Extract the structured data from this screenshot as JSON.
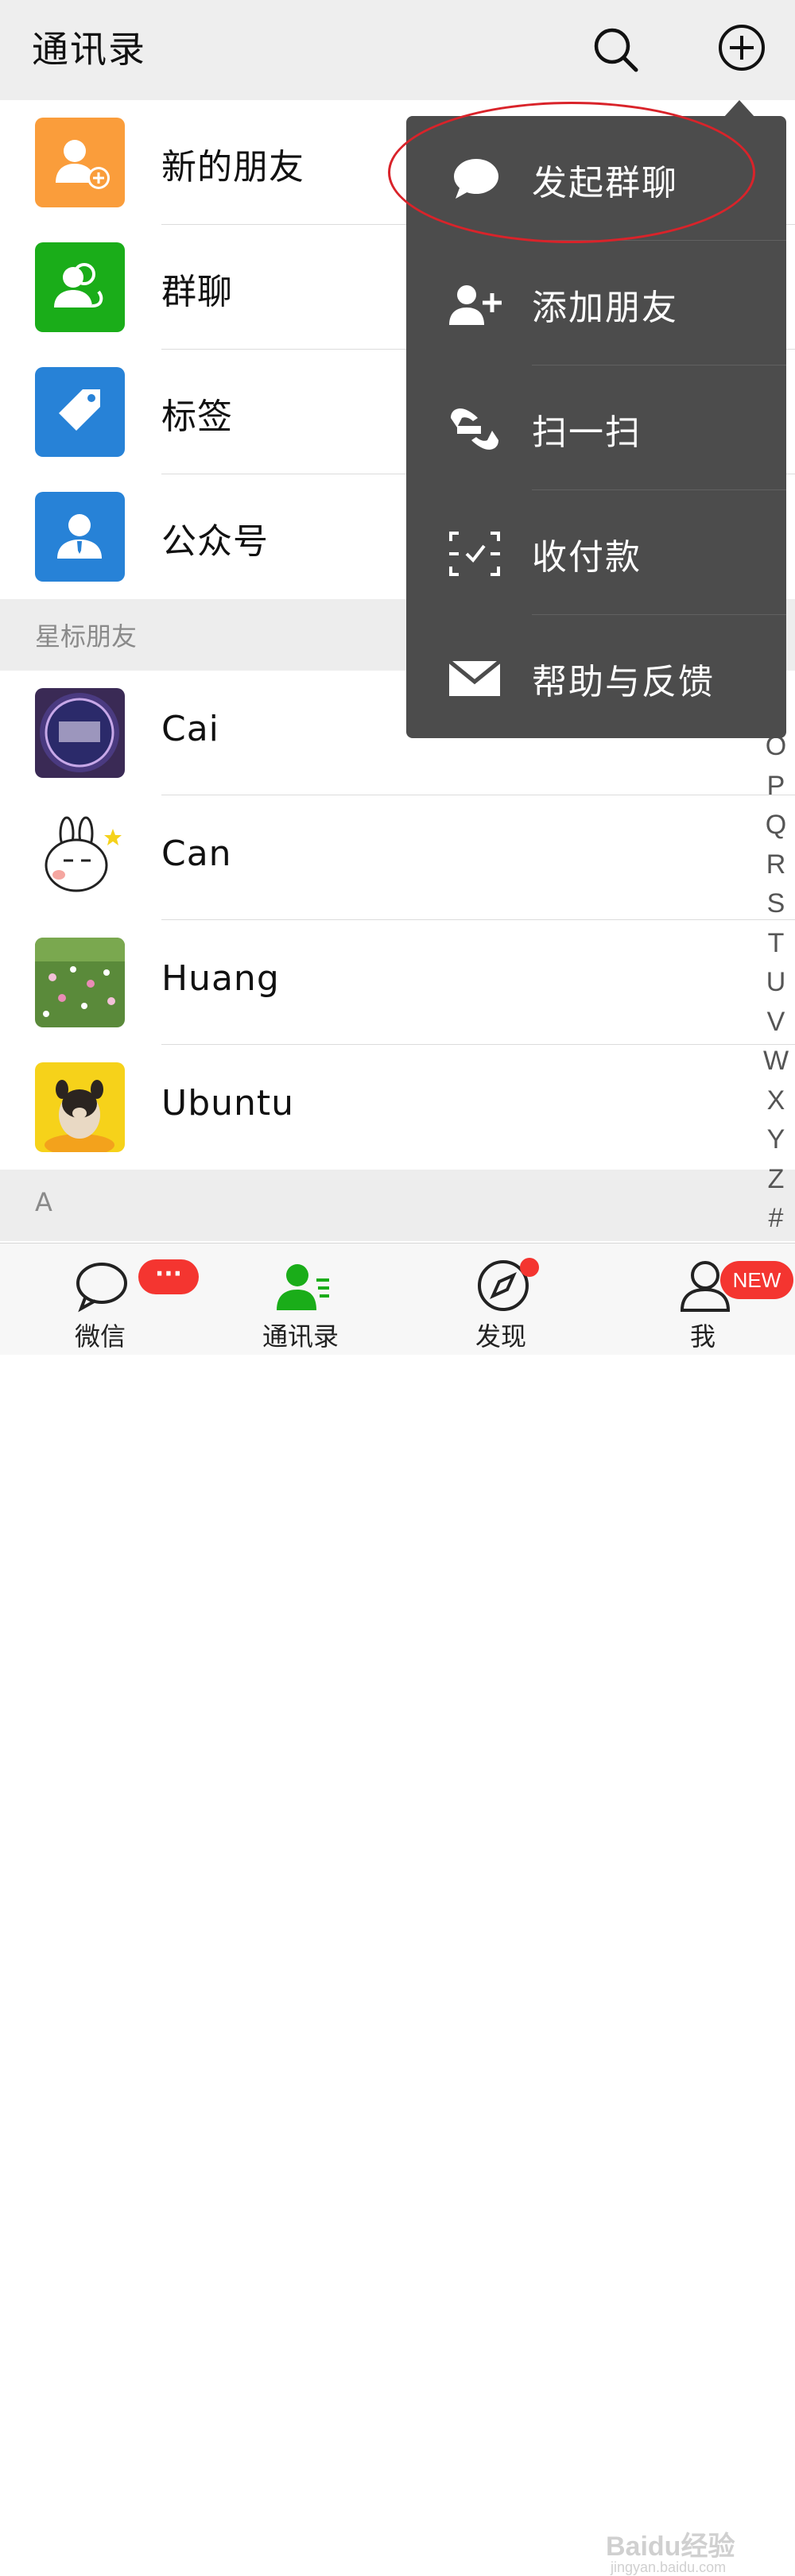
{
  "header": {
    "title": "通讯录",
    "search_icon": "search-icon",
    "add_icon": "add-circle-icon"
  },
  "top_items": [
    {
      "label": "新的朋友",
      "icon": "add-friend-icon",
      "color": "#fa9d3b"
    },
    {
      "label": "群聊",
      "icon": "group-icon",
      "color": "#1aad19"
    },
    {
      "label": "标签",
      "icon": "tag-icon",
      "color": "#2782d7"
    },
    {
      "label": "公众号",
      "icon": "official-account-icon",
      "color": "#2782d7"
    }
  ],
  "starred_section": {
    "title": "星标朋友",
    "contacts": [
      {
        "name": "Cai",
        "avatar": "cai-avatar"
      },
      {
        "name": "Can",
        "avatar": "can-avatar"
      },
      {
        "name": "Huang",
        "avatar": "huang-avatar"
      },
      {
        "name": "Ubuntu",
        "avatar": "ubuntu-avatar"
      }
    ]
  },
  "section_a": {
    "title": "A"
  },
  "index_letters": [
    "O",
    "P",
    "Q",
    "R",
    "S",
    "T",
    "U",
    "V",
    "W",
    "X",
    "Y",
    "Z",
    "#"
  ],
  "popup_menu": {
    "items": [
      {
        "label": "发起群聊",
        "icon": "chat-bubble-icon",
        "highlighted": true
      },
      {
        "label": "添加朋友",
        "icon": "add-friend-icon"
      },
      {
        "label": "扫一扫",
        "icon": "scan-icon"
      },
      {
        "label": "收付款",
        "icon": "payment-icon"
      },
      {
        "label": "帮助与反馈",
        "icon": "mail-icon"
      }
    ],
    "highlight_color": "#d9232a"
  },
  "tabbar": {
    "tabs": [
      {
        "label": "微信",
        "icon": "chat-icon",
        "badge": "···"
      },
      {
        "label": "通讯录",
        "icon": "contacts-icon",
        "active": true
      },
      {
        "label": "发现",
        "icon": "compass-icon"
      },
      {
        "label": "我",
        "icon": "me-icon",
        "badge": "NEW"
      }
    ],
    "active_color": "#1aad19",
    "badge_color": "#f43530"
  },
  "watermark": {
    "brand": "Baidu经验",
    "url": "jingyan.baidu.com"
  }
}
